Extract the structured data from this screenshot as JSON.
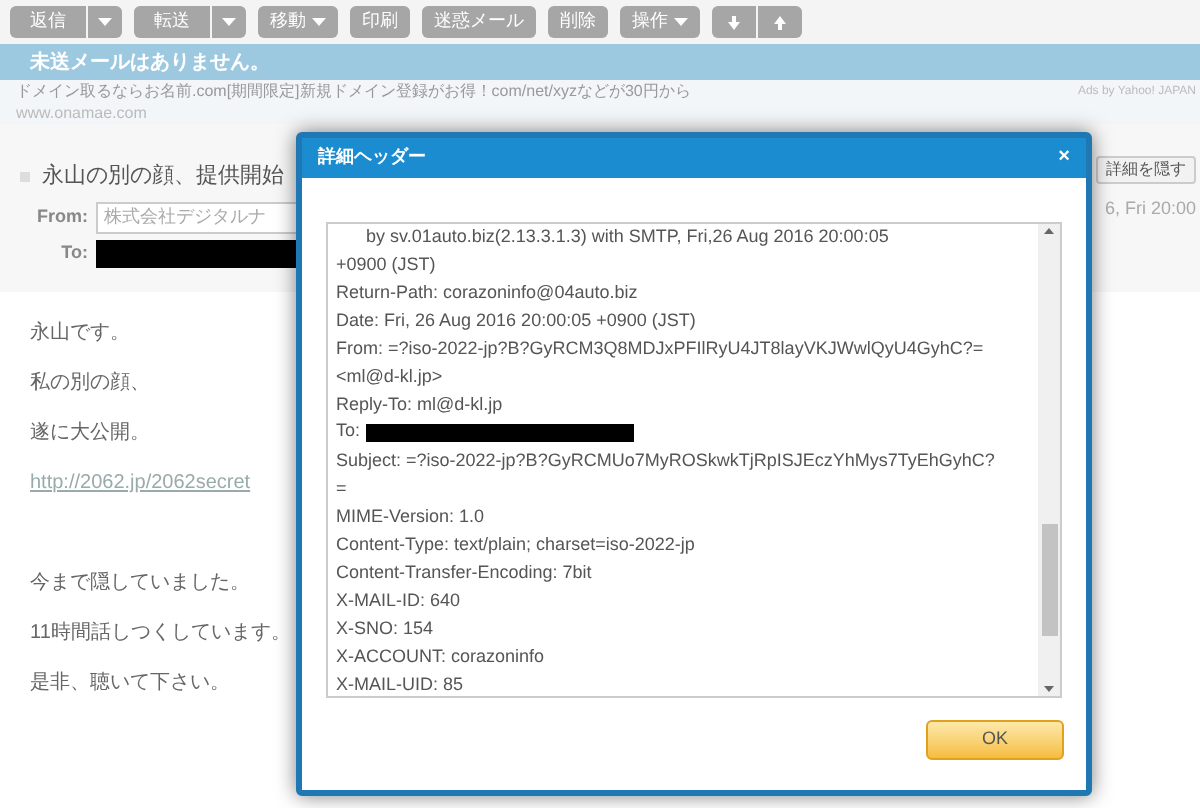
{
  "toolbar": [
    {
      "label": "返信",
      "kind": "split"
    },
    {
      "label": "転送",
      "kind": "split"
    },
    {
      "label": "移動",
      "kind": "menu"
    },
    {
      "label": "印刷",
      "kind": "plain"
    },
    {
      "label": "迷惑メール",
      "kind": "plain"
    },
    {
      "label": "削除",
      "kind": "plain"
    },
    {
      "label": "操作",
      "kind": "menu"
    },
    {
      "kind": "arrows"
    }
  ],
  "notice": "未送メールはありません。",
  "ad": {
    "text": "ドメイン取るならお名前.com[期間限定]新規ドメイン登録がお得！com/net/xyzなどが30円から",
    "url": "www.onamae.com",
    "credit": "Ads by Yahoo! JAPAN"
  },
  "message": {
    "subject": "永山の別の顔、提供開始",
    "from_label": "From:",
    "from": "株式会社デジタルナ",
    "to_label": "To:",
    "date": "6, Fri 20:00",
    "hide_details": "詳細を隠す",
    "body": [
      {
        "kind": "text",
        "text": "永山です。"
      },
      {
        "kind": "text",
        "text": "私の別の顔、"
      },
      {
        "kind": "text",
        "text": "遂に大公開。"
      },
      {
        "kind": "link",
        "text": "http://2062.jp/2062secret"
      },
      {
        "kind": "gap"
      },
      {
        "kind": "text",
        "text": "今まで隠していました。"
      },
      {
        "kind": "text",
        "text": "11時間話しつくしています。"
      },
      {
        "kind": "text",
        "text": "是非、聴いて下さい。"
      }
    ]
  },
  "dialog": {
    "title": "詳細ヘッダー",
    "close": "×",
    "ok": "OK",
    "lines": [
      {
        "kind": "text",
        "text": "      by sv.01auto.biz(2.13.3.1.3) with SMTP, Fri,26 Aug 2016 20:00:05"
      },
      {
        "kind": "text",
        "text": "+0900 (JST)"
      },
      {
        "kind": "text",
        "text": "Return-Path: corazoninfo@04auto.biz"
      },
      {
        "kind": "text",
        "text": "Date: Fri, 26 Aug 2016 20:00:05 +0900 (JST)"
      },
      {
        "kind": "text",
        "text": "From: =?iso-2022-jp?B?GyRCM3Q8MDJxPFIlRyU4JT8layVKJWwlQyU4GyhC?="
      },
      {
        "kind": "text",
        "text": "<ml@d-kl.jp>"
      },
      {
        "kind": "text",
        "text": "Reply-To: ml@d-kl.jp"
      },
      {
        "kind": "redacted",
        "text": "To:"
      },
      {
        "kind": "text",
        "text": "Subject: =?iso-2022-jp?B?GyRCMUo7MyROSkwkTjRpISJEczYhMys7TyEhGyhC?"
      },
      {
        "kind": "text",
        "text": "="
      },
      {
        "kind": "text",
        "text": "MIME-Version: 1.0"
      },
      {
        "kind": "text",
        "text": "Content-Type: text/plain; charset=iso-2022-jp"
      },
      {
        "kind": "text",
        "text": "Content-Transfer-Encoding: 7bit"
      },
      {
        "kind": "text",
        "text": "X-MAIL-ID: 640"
      },
      {
        "kind": "text",
        "text": "X-SNO: 154"
      },
      {
        "kind": "text",
        "text": "X-ACCOUNT: corazoninfo"
      },
      {
        "kind": "text",
        "text": "X-MAIL-UID: 85"
      }
    ]
  }
}
